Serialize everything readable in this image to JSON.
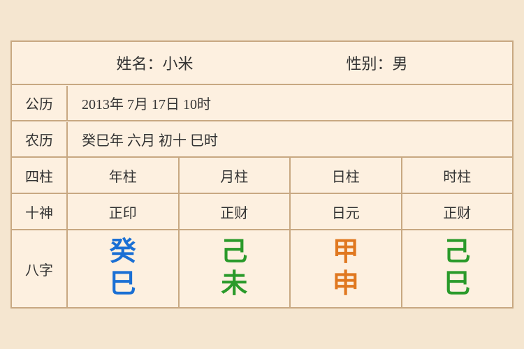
{
  "header": {
    "name_label": "姓名：小米",
    "gender_label": "性别：男"
  },
  "gregorian": {
    "label": "公历",
    "value": "2013年 7月 17日 10时"
  },
  "lunar": {
    "label": "农历",
    "value": "癸巳年 六月 初十 巳时"
  },
  "columns": {
    "label": "四柱",
    "headers": [
      "年柱",
      "月柱",
      "日柱",
      "时柱"
    ]
  },
  "shishen": {
    "label": "十神",
    "values": [
      "正印",
      "正财",
      "日元",
      "正财"
    ]
  },
  "bazhi": {
    "label": "八字",
    "cells": [
      {
        "top": "癸",
        "bottom": "巳",
        "top_color": "blue",
        "bottom_color": "blue"
      },
      {
        "top": "己",
        "bottom": "未",
        "top_color": "green",
        "bottom_color": "green"
      },
      {
        "top": "甲",
        "bottom": "申",
        "top_color": "orange",
        "bottom_color": "orange"
      },
      {
        "top": "己",
        "bottom": "巳",
        "top_color": "green",
        "bottom_color": "green"
      }
    ]
  }
}
